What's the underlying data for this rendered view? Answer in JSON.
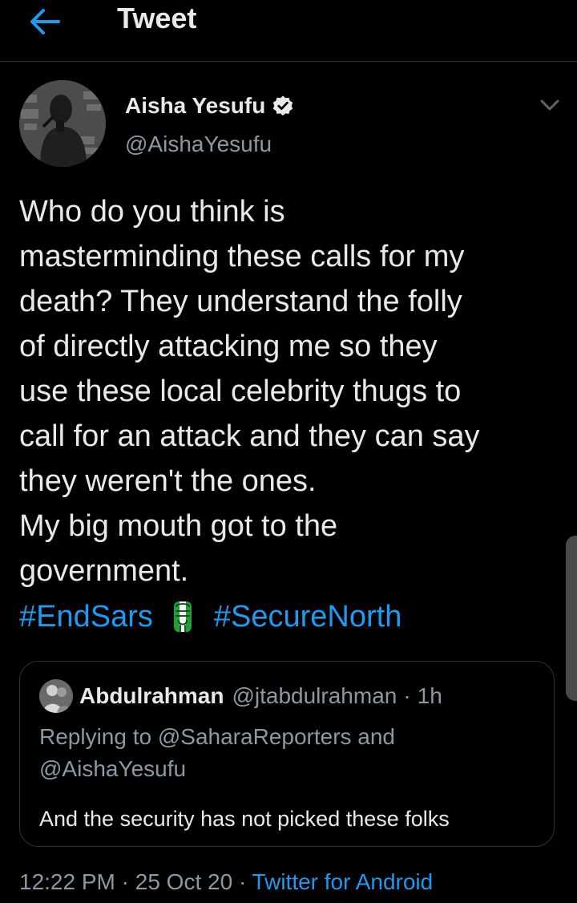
{
  "header": {
    "title": "Tweet",
    "back_icon": "arrow-left-icon"
  },
  "colors": {
    "background": "#000000",
    "accent": "#1d9bf0",
    "text": "#e7e9ea",
    "muted": "#8b98a5",
    "border": "#2f3336"
  },
  "author": {
    "name": "Aisha Yesufu",
    "handle": "@AishaYesufu",
    "verified_icon": "verified-badge-icon"
  },
  "tweet": {
    "lines": [
      "Who do you think is",
      "masterminding these calls for my",
      "death? They understand the folly",
      "of directly attacking me so they",
      "use these local celebrity thugs to",
      "call for an attack and they can say",
      "they weren't the ones.",
      "My big mouth got to the",
      "government."
    ],
    "hashtags": [
      "#EndSars",
      "#SecureNorth"
    ],
    "emoji": "raised-fist-icon"
  },
  "quote": {
    "name": "Abdulrahman",
    "handle": "@jtabdulrahman",
    "separator": "·",
    "time": "1h",
    "reply_lines": [
      "Replying to @SaharaReporters and",
      "@AishaYesufu"
    ],
    "text": "And the security has not picked these folks"
  },
  "meta": {
    "time": "12:22 PM",
    "separator": "·",
    "date": "25 Oct 20",
    "source": "Twitter for Android"
  }
}
